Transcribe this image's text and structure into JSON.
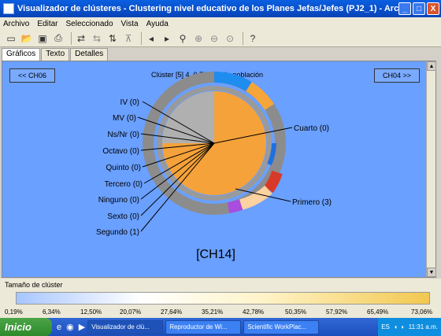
{
  "window": {
    "title": "Visualizador de clústeres - Clustering nivel educativo de los Planes Jefas/Jefes (PJ2_1) - Archivo local: general l...",
    "minimize": "_",
    "maximize": "□",
    "close": "X"
  },
  "menu": [
    "Archivo",
    "Editar",
    "Seleccionado",
    "Vista",
    "Ayuda"
  ],
  "tabs": [
    "Gráficos",
    "Texto",
    "Detalles"
  ],
  "nav": {
    "prev": "<< CH06",
    "next": "CH04 >>"
  },
  "cluster_title": "Clúster [5] 4, 0,76% de la población",
  "center_label": "[CH14]",
  "pie_labels": [
    "IV (0)",
    "MV (0)",
    "Ns/Nr (0)",
    "Octavo (0)",
    "Quinto (0)",
    "Tercero (0)",
    "Ninguno (0)",
    "Sexto (0)",
    "Segundo (1)",
    "Cuarto (0)",
    "Primero (3)"
  ],
  "size_panel": {
    "label": "Tamaño de clúster",
    "ticks": [
      "0,19%",
      "6,34%",
      "12,50%",
      "20,07%",
      "27,64%",
      "35,21%",
      "42,78%",
      "50,35%",
      "57,92%",
      "65,49%",
      "73,06%"
    ]
  },
  "taskbar": {
    "start": "Inicio",
    "tasks": [
      "Visualizador de clú...",
      "Reproductor de Wi...",
      "Scientific WorkPlac..."
    ],
    "lang": "ES",
    "clock": "11:31 a.m."
  },
  "chart_data": {
    "type": "pie",
    "categories": [
      "Primero",
      "Segundo",
      "Cuarto",
      "IV",
      "MV",
      "Ns/Nr",
      "Octavo",
      "Quinto",
      "Tercero",
      "Ninguno",
      "Sexto"
    ],
    "values": [
      3,
      1,
      0,
      0,
      0,
      0,
      0,
      0,
      0,
      0,
      0
    ]
  }
}
